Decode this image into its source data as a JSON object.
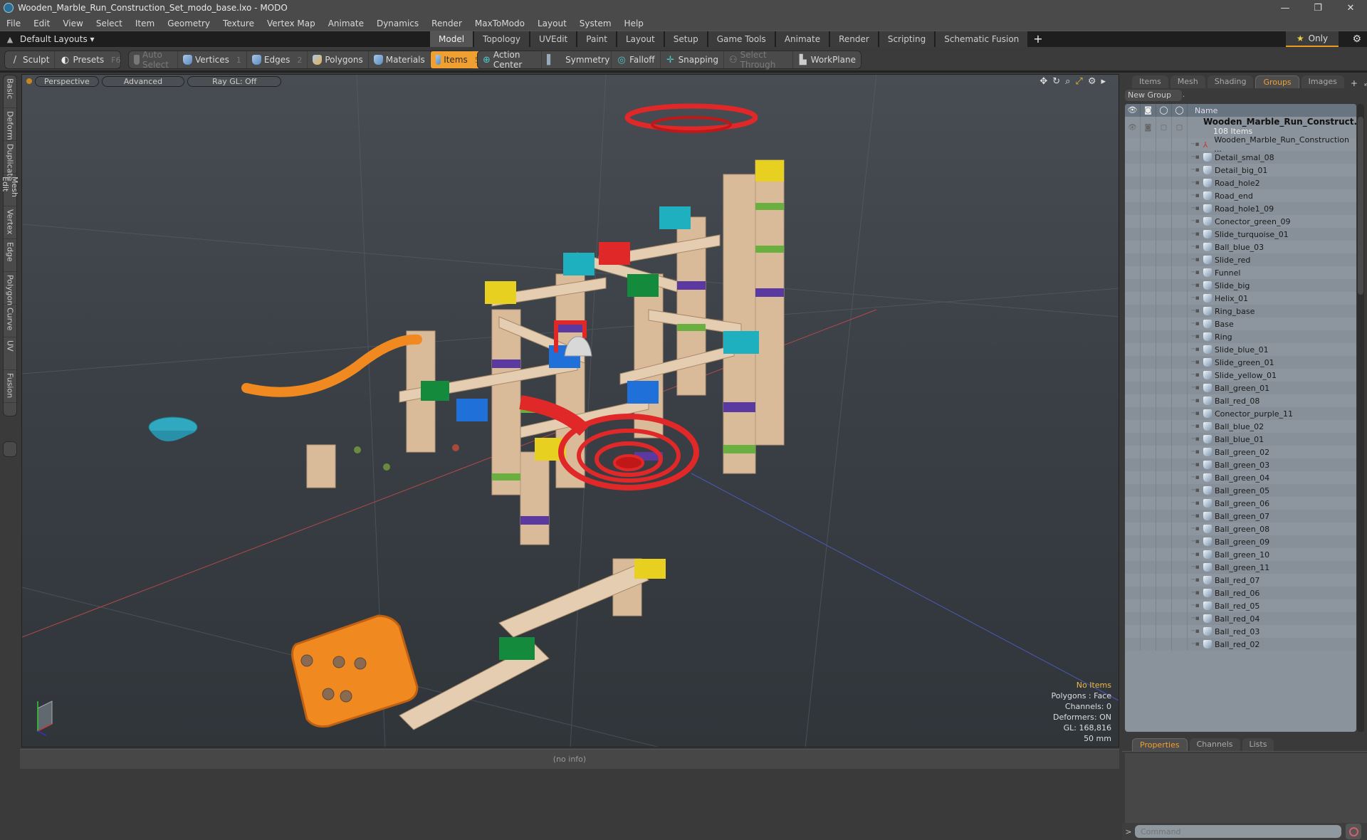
{
  "window": {
    "title": "Wooden_Marble_Run_Construction_Set_modo_base.lxo - MODO",
    "controls": [
      "minimize",
      "maximize",
      "close"
    ]
  },
  "menu": [
    "File",
    "Edit",
    "View",
    "Select",
    "Item",
    "Geometry",
    "Texture",
    "Vertex Map",
    "Animate",
    "Dynamics",
    "Render",
    "MaxToModo",
    "Layout",
    "System",
    "Help"
  ],
  "layoutbar": {
    "layout_selector": "Default Layouts ▾",
    "mode_tabs": [
      "Model",
      "Topology",
      "UVEdit",
      "Paint",
      "Layout",
      "Setup",
      "Game Tools",
      "Animate",
      "Render",
      "Scripting",
      "Schematic Fusion"
    ],
    "active_mode": "Model",
    "add_tab": "+",
    "only_label": "Only"
  },
  "toolbar": {
    "sculpt": "Sculpt",
    "presets": "Presets",
    "presets_hotkey": "F6",
    "auto_select": "Auto Select",
    "vertices": "Vertices",
    "vertices_hotkey": "1",
    "edges": "Edges",
    "edges_hotkey": "2",
    "polygons": "Polygons",
    "materials": "Materials",
    "items": "Items",
    "items_hotkey": "5",
    "action_center": "Action Center",
    "symmetry": "Symmetry",
    "falloff": "Falloff",
    "snapping": "Snapping",
    "select_through": "Select Through",
    "workplane": "WorkPlane"
  },
  "left_tabs": [
    "Basic",
    "Deform",
    "Duplicate",
    "Mesh Edit",
    "Vertex",
    "Edge",
    "Polygon",
    "Curve",
    "UV",
    "Fusion"
  ],
  "viewport": {
    "view_mode": "Perspective",
    "shading": "Advanced",
    "raygl": "Ray GL: Off",
    "info": {
      "selection": "No Items",
      "polygons": "Polygons : Face",
      "channels": "Channels: 0",
      "deformers": "Deformers: ON",
      "gl": "GL: 168,816",
      "scale": "50 mm"
    }
  },
  "statusbar": {
    "text": "(no info)"
  },
  "right_panel": {
    "tabs": [
      "Items",
      "Mesh ...",
      "Shading",
      "Groups",
      "Images"
    ],
    "active_tab": "Groups",
    "new_group": "New Group",
    "column_name": "Name",
    "group": {
      "name": "Wooden_Marble_Run_Construct...",
      "count": "108 Items"
    },
    "items": [
      "Wooden_Marble_Run_Construction ...",
      "Detail_smal_08",
      "Detail_big_01",
      "Road_hole2",
      "Road_end",
      "Road_hole1_09",
      "Conector_green_09",
      "Slide_turquoise_01",
      "Ball_blue_03",
      "Slide_red",
      "Funnel",
      "Slide_big",
      "Helix_01",
      "Ring_base",
      "Base",
      "Ring",
      "Slide_blue_01",
      "Slide_green_01",
      "Slide_yellow_01",
      "Ball_green_01",
      "Ball_red_08",
      "Conector_purple_11",
      "Ball_blue_02",
      "Ball_blue_01",
      "Ball_green_02",
      "Ball_green_03",
      "Ball_green_04",
      "Ball_green_05",
      "Ball_green_06",
      "Ball_green_07",
      "Ball_green_08",
      "Ball_green_09",
      "Ball_green_10",
      "Ball_green_11",
      "Ball_red_07",
      "Ball_red_06",
      "Ball_red_05",
      "Ball_red_04",
      "Ball_red_03",
      "Ball_red_02"
    ],
    "bottom_tabs": [
      "Properties",
      "Channels",
      "Lists"
    ],
    "active_bottom_tab": "Properties",
    "command_placeholder": "Command"
  },
  "colors": {
    "accent": "#f0a030",
    "viewport_bg": "#3b4046",
    "outliner_bg": "#8a939b"
  }
}
